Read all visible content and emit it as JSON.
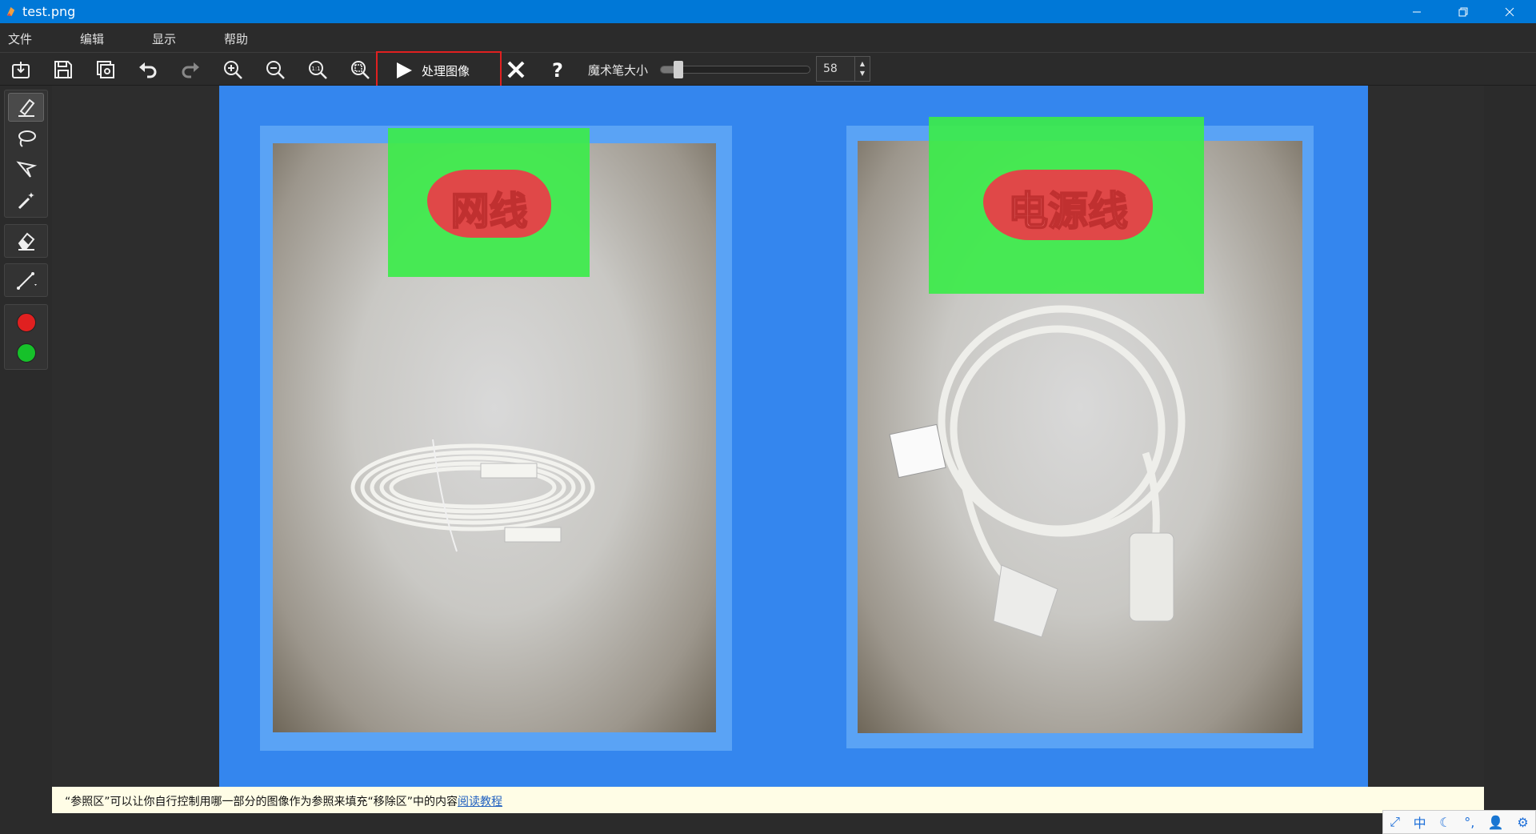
{
  "window": {
    "title": "test.png"
  },
  "menu": {
    "file": "文件",
    "edit": "编辑",
    "view": "显示",
    "help": "帮助"
  },
  "toolbar": {
    "process_label": "处理图像",
    "brush_size_label": "魔术笔大小",
    "brush_size_value": "58",
    "brush_size_level": 0.1
  },
  "canvas": {
    "left_label": "网线",
    "right_label": "电源线"
  },
  "status": {
    "message": "“参照区”可以让你自行控制用哪一部分的图像作为参照来填充“移除区”中的内容",
    "link": "阅读教程"
  },
  "ime": {
    "mode": "中"
  },
  "colors": {
    "accent": "#0078d7",
    "canvas_bg": "#3486ee",
    "reference_green": "#3cec4a",
    "remove_red": "#e04848"
  }
}
